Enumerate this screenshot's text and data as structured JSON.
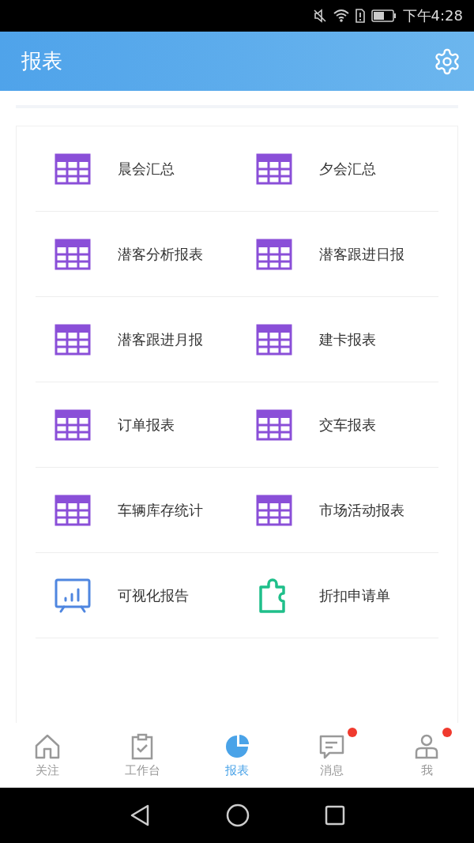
{
  "status_bar": {
    "time": "下午4:28"
  },
  "header": {
    "title": "报表"
  },
  "reports": [
    {
      "label": "晨会汇总",
      "kind": "table"
    },
    {
      "label": "夕会汇总",
      "kind": "table"
    },
    {
      "label": "潜客分析报表",
      "kind": "table"
    },
    {
      "label": "潜客跟进日报",
      "kind": "table"
    },
    {
      "label": "潜客跟进月报",
      "kind": "table"
    },
    {
      "label": "建卡报表",
      "kind": "table"
    },
    {
      "label": "订单报表",
      "kind": "table"
    },
    {
      "label": "交车报表",
      "kind": "table"
    },
    {
      "label": "车辆库存统计",
      "kind": "table"
    },
    {
      "label": "市场活动报表",
      "kind": "table"
    },
    {
      "label": "可视化报告",
      "kind": "presentation"
    },
    {
      "label": "折扣申请单",
      "kind": "puzzle"
    }
  ],
  "tabs": [
    {
      "label": "关注",
      "kind": "home",
      "selected": false,
      "badge": false
    },
    {
      "label": "工作台",
      "kind": "clipboard",
      "selected": false,
      "badge": false
    },
    {
      "label": "报表",
      "kind": "pie",
      "selected": true,
      "badge": false
    },
    {
      "label": "消息",
      "kind": "message",
      "selected": false,
      "badge": true
    },
    {
      "label": "我",
      "kind": "person",
      "selected": false,
      "badge": true
    }
  ]
}
